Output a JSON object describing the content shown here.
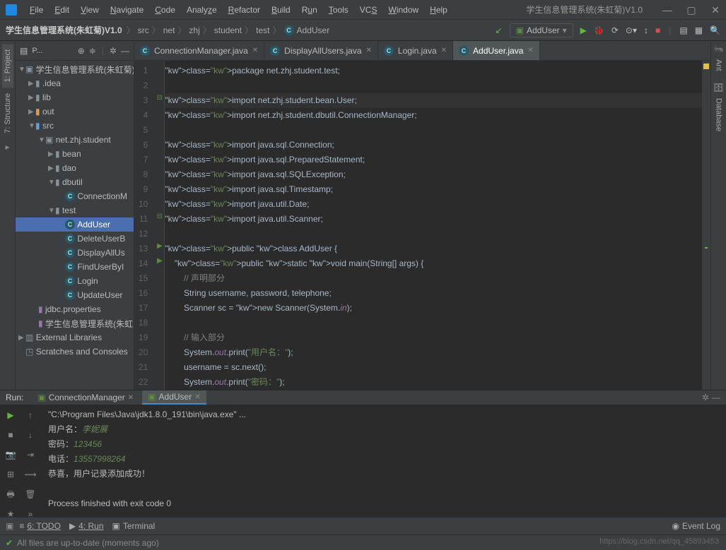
{
  "app": {
    "title": "学生信息管理系统(朱虹菊)V1.0",
    "menus": [
      "File",
      "Edit",
      "View",
      "Navigate",
      "Code",
      "Analyze",
      "Refactor",
      "Build",
      "Run",
      "Tools",
      "VCS",
      "Window",
      "Help"
    ],
    "win_min": "—",
    "win_max": "▢",
    "win_close": "✕"
  },
  "nav": {
    "project": "学生信息管理系统(朱虹菊)V1.0",
    "crumbs": [
      "src",
      "net",
      "zhj",
      "student",
      "test"
    ],
    "leaf": "AddUser",
    "run_config": "AddUser"
  },
  "project_panel": {
    "title": "P...",
    "root": "学生信息管理系统(朱虹菊)",
    "idea": ".idea",
    "lib": "lib",
    "out": "out",
    "src": "src",
    "pkg": "net.zhj.student",
    "bean": "bean",
    "dao": "dao",
    "dbutil": "dbutil",
    "conn": "ConnectionM",
    "test": "test",
    "cls": {
      "add": "AddUser",
      "del": "DeleteUserB",
      "disp": "DisplayAllUs",
      "find": "FindUserByI",
      "login": "Login",
      "upd": "UpdateUser"
    },
    "jdbc": "jdbc.properties",
    "iml": "学生信息管理系统(朱虹",
    "ext": "External Libraries",
    "scratch": "Scratches and Consoles"
  },
  "tabs": {
    "t1": "ConnectionManager.java",
    "t2": "DisplayAllUsers.java",
    "t3": "Login.java",
    "t4": "AddUser.java"
  },
  "code": {
    "lines": [
      "package net.zhj.student.test;",
      "",
      "import net.zhj.student.bean.User;",
      "import net.zhj.student.dbutil.ConnectionManager;",
      "",
      "import java.sql.Connection;",
      "import java.sql.PreparedStatement;",
      "import java.sql.SQLException;",
      "import java.sql.Timestamp;",
      "import java.util.Date;",
      "import java.util.Scanner;",
      "",
      "public class AddUser {",
      "    public static void main(String[] args) {",
      "        // 声明部分",
      "        String username, password, telephone;",
      "        Scanner sc = new Scanner(System.in);",
      "",
      "        // 输入部分",
      "        System.out.print(\"用户名：\");",
      "        username = sc.next();",
      "        System.out.print(\"密码：\");"
    ]
  },
  "run": {
    "title": "Run:",
    "tab1": "ConnectionManager",
    "tab2": "AddUser",
    "out": {
      "cmd": "\"C:\\Program Files\\Java\\jdk1.8.0_191\\bin\\java.exe\" ...",
      "l1a": "用户名：",
      "l1b": "李妮展",
      "l2a": "密码：",
      "l2b": "123456",
      "l3a": "电话：",
      "l3b": "13557998264",
      "l4": "恭喜，用户记录添加成功！",
      "exit": "Process finished with exit code 0"
    }
  },
  "status": {
    "todo": "6: TODO",
    "run": "4: Run",
    "term": "Terminal",
    "log": "Event Log",
    "msg": "All files are up-to-date (moments ago)"
  },
  "watermark": "https://blog.csdn.net/qq_45893453"
}
